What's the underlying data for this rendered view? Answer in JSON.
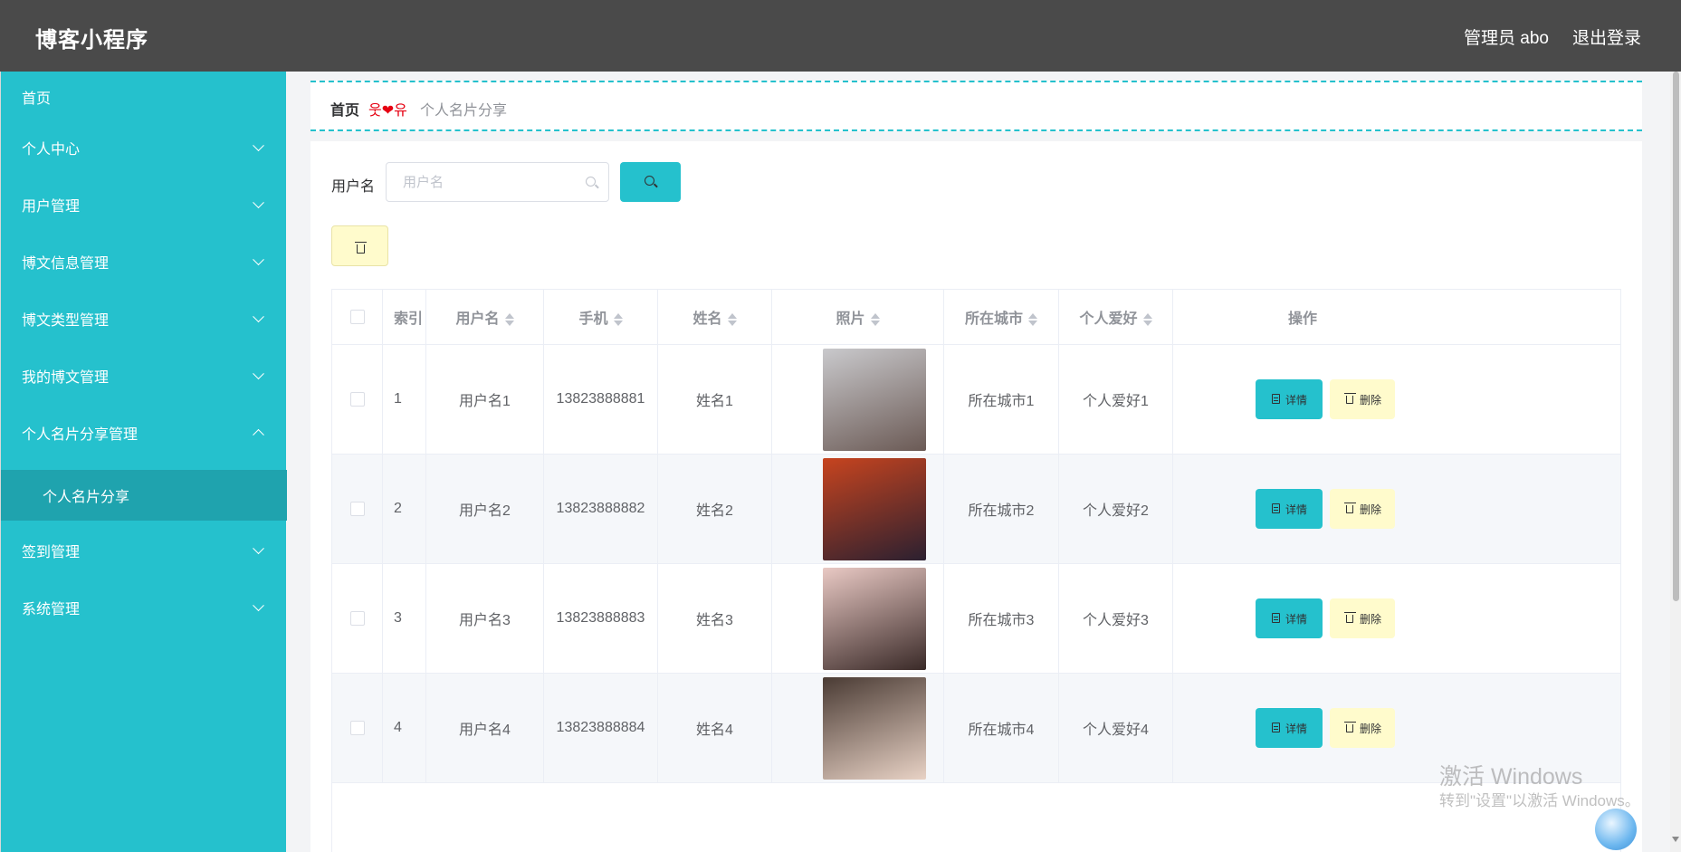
{
  "app": {
    "title": "博客小程序"
  },
  "header": {
    "user": "管理员 abo",
    "logout": "退出登录"
  },
  "sidebar": {
    "items": [
      {
        "label": "首页",
        "arrow": "none"
      },
      {
        "label": "个人中心",
        "arrow": "down"
      },
      {
        "label": "用户管理",
        "arrow": "down"
      },
      {
        "label": "博文信息管理",
        "arrow": "down"
      },
      {
        "label": "博文类型管理",
        "arrow": "down"
      },
      {
        "label": "我的博文管理",
        "arrow": "down"
      },
      {
        "label": "个人名片分享管理",
        "arrow": "up"
      },
      {
        "label": "个人名片分享",
        "arrow": "none",
        "sub": true,
        "active": true
      },
      {
        "label": "签到管理",
        "arrow": "down"
      },
      {
        "label": "系统管理",
        "arrow": "down"
      }
    ]
  },
  "breadcrumb": {
    "home": "首页",
    "separator": "웃❤유",
    "current": "个人名片分享"
  },
  "search": {
    "label": "用户名",
    "placeholder": "用户名",
    "value": ""
  },
  "table": {
    "columns": [
      "索引",
      "用户名",
      "手机",
      "姓名",
      "照片",
      "所在城市",
      "个人爱好",
      "操作"
    ],
    "rows": [
      {
        "index": "1",
        "username": "用户名1",
        "phone": "13823888881",
        "name": "姓名1",
        "city": "所在城市1",
        "hobby": "个人爱好1",
        "photo_colors": [
          "#c9c9cc",
          "#6b5a55"
        ]
      },
      {
        "index": "2",
        "username": "用户名2",
        "phone": "13823888882",
        "name": "姓名2",
        "city": "所在城市2",
        "hobby": "个人爱好2",
        "photo_colors": [
          "#c7441f",
          "#2b2030"
        ]
      },
      {
        "index": "3",
        "username": "用户名3",
        "phone": "13823888883",
        "name": "姓名3",
        "city": "所在城市3",
        "hobby": "个人爱好3",
        "photo_colors": [
          "#e9c9c4",
          "#3a2a28"
        ]
      },
      {
        "index": "4",
        "username": "用户名4",
        "phone": "13823888884",
        "name": "姓名4",
        "city": "所在城市4",
        "hobby": "个人爱好4",
        "photo_colors": [
          "#4a3b34",
          "#e8d2c5"
        ]
      }
    ],
    "actions": {
      "detail": "详情",
      "delete": "删除"
    }
  },
  "watermark": {
    "line1": "激活 Windows",
    "line2": "转到\"设置\"以激活 Windows。"
  },
  "colors": {
    "accent": "#25c1cd",
    "header": "#4a4a4a",
    "delete_bg": "#fffbcc",
    "separator": "#e60012"
  }
}
